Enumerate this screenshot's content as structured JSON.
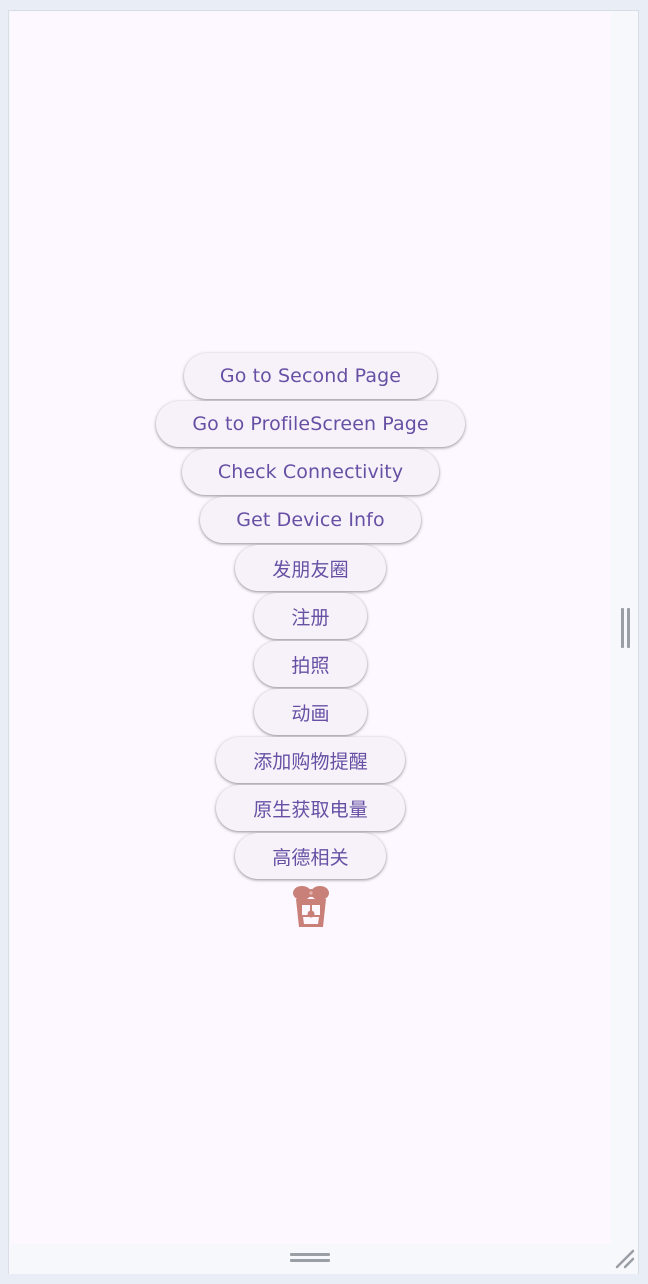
{
  "buttons": [
    "Go to Second Page",
    "Go to ProfileScreen Page",
    "Check Connectivity",
    "Get Device Info",
    "发朋友圈",
    "注册",
    "拍照",
    "动画",
    "添加购物提醒",
    "原生获取电量",
    "高德相关"
  ],
  "icons": {
    "gift": "gift-icon",
    "side_handle": "vertical-resize-handle-icon",
    "bottom_handle": "horizontal-resize-handle-icon",
    "corner_grip": "resize-grip-icon"
  },
  "colors": {
    "surface": "#fdf7ff",
    "button_bg": "#f7f2fa",
    "button_text": "#6750a4",
    "gift": "#c98078"
  }
}
